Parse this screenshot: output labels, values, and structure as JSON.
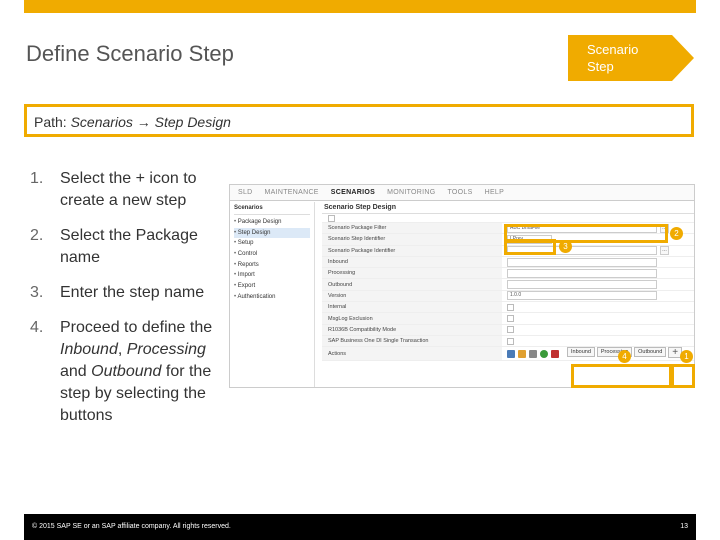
{
  "slide": {
    "title": "Define Scenario Step",
    "badge_line1": "Scenario",
    "badge_line2": "Step",
    "path_prefix": "Path: ",
    "path_value": "Scenarios →  Step Design",
    "accent_color": "#f0ab00"
  },
  "steps": [
    {
      "num": "1.",
      "text": "Select the + icon to create a new step"
    },
    {
      "num": "2.",
      "text": "Select the Package name"
    },
    {
      "num": "3.",
      "text": "Enter the step name"
    },
    {
      "num": "4.",
      "text_parts": [
        "Proceed to define the ",
        "Inbound",
        ", ",
        "Processing",
        " and ",
        "Outbound",
        " for the step by selecting the buttons"
      ]
    }
  ],
  "app": {
    "nav": [
      "SLD",
      "MAINTENANCE",
      "SCENARIOS",
      "MONITORING",
      "TOOLS",
      "HELP"
    ],
    "nav_active": "SCENARIOS",
    "sidebar_title": "Scenarios",
    "sidebar_items": [
      "Package Design",
      "Step Design",
      "Setup",
      "Control",
      "Reports",
      "Import",
      "Export",
      "Authentication"
    ],
    "sidebar_selected": "Step Design",
    "content_title": "Scenario Step Design",
    "rows": [
      {
        "label": "Scenario Package Filter",
        "value": "ABC BmaFile"
      },
      {
        "label": "Scenario Step Identifier",
        "value": "LPrev"
      },
      {
        "label": "Scenario Package Identifier",
        "value": ""
      },
      {
        "label": "Inbound",
        "value": ""
      },
      {
        "label": "Processing",
        "value": ""
      },
      {
        "label": "Outbound",
        "value": ""
      },
      {
        "label": "Version",
        "value": "1.0.0"
      },
      {
        "label": "Internal",
        "value": ""
      },
      {
        "label": "MsgLog Exclusion",
        "value": ""
      },
      {
        "label": "R1036B Compatibility Mode",
        "value": ""
      },
      {
        "label": "SAP Business One DI Single Transaction",
        "value": ""
      },
      {
        "label": "Actions",
        "value": ""
      }
    ],
    "action_buttons": [
      "Inbound",
      "Processing",
      "Outbound"
    ],
    "add_label": "+"
  },
  "markers": [
    "1",
    "2",
    "3",
    "4"
  ],
  "footer": {
    "copyright": "© 2015 SAP SE or an SAP affiliate company. All rights reserved.",
    "page": "13"
  }
}
